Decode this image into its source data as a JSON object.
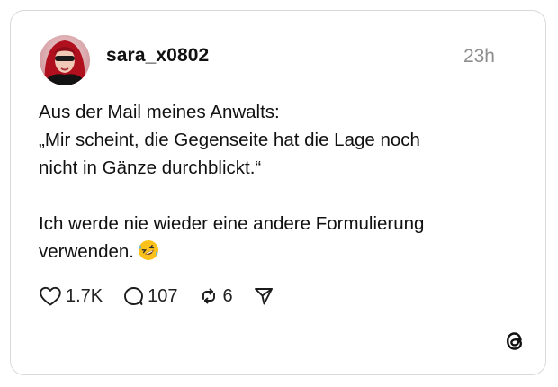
{
  "post": {
    "username": "sara_x0802",
    "timestamp": "23h",
    "lines": [
      "Aus der Mail meines Anwalts:",
      "„Mir scheint, die Gegenseite hat die Lage noch",
      "nicht in Gänze durchblickt.“",
      "Ich werde nie wieder eine andere Formulierung",
      "verwenden."
    ],
    "emoji": "rolling-on-the-floor-laughing"
  },
  "actions": {
    "likes": "1.7K",
    "replies": "107",
    "reposts": "6"
  },
  "icons": {
    "like": "heart-icon",
    "reply": "comment-bubble-icon",
    "repost": "repost-icon",
    "share": "send-icon",
    "brand": "threads-logo-icon"
  },
  "colors": {
    "text": "#111111",
    "muted": "#8e8e8e",
    "border": "#d9d9d9"
  }
}
